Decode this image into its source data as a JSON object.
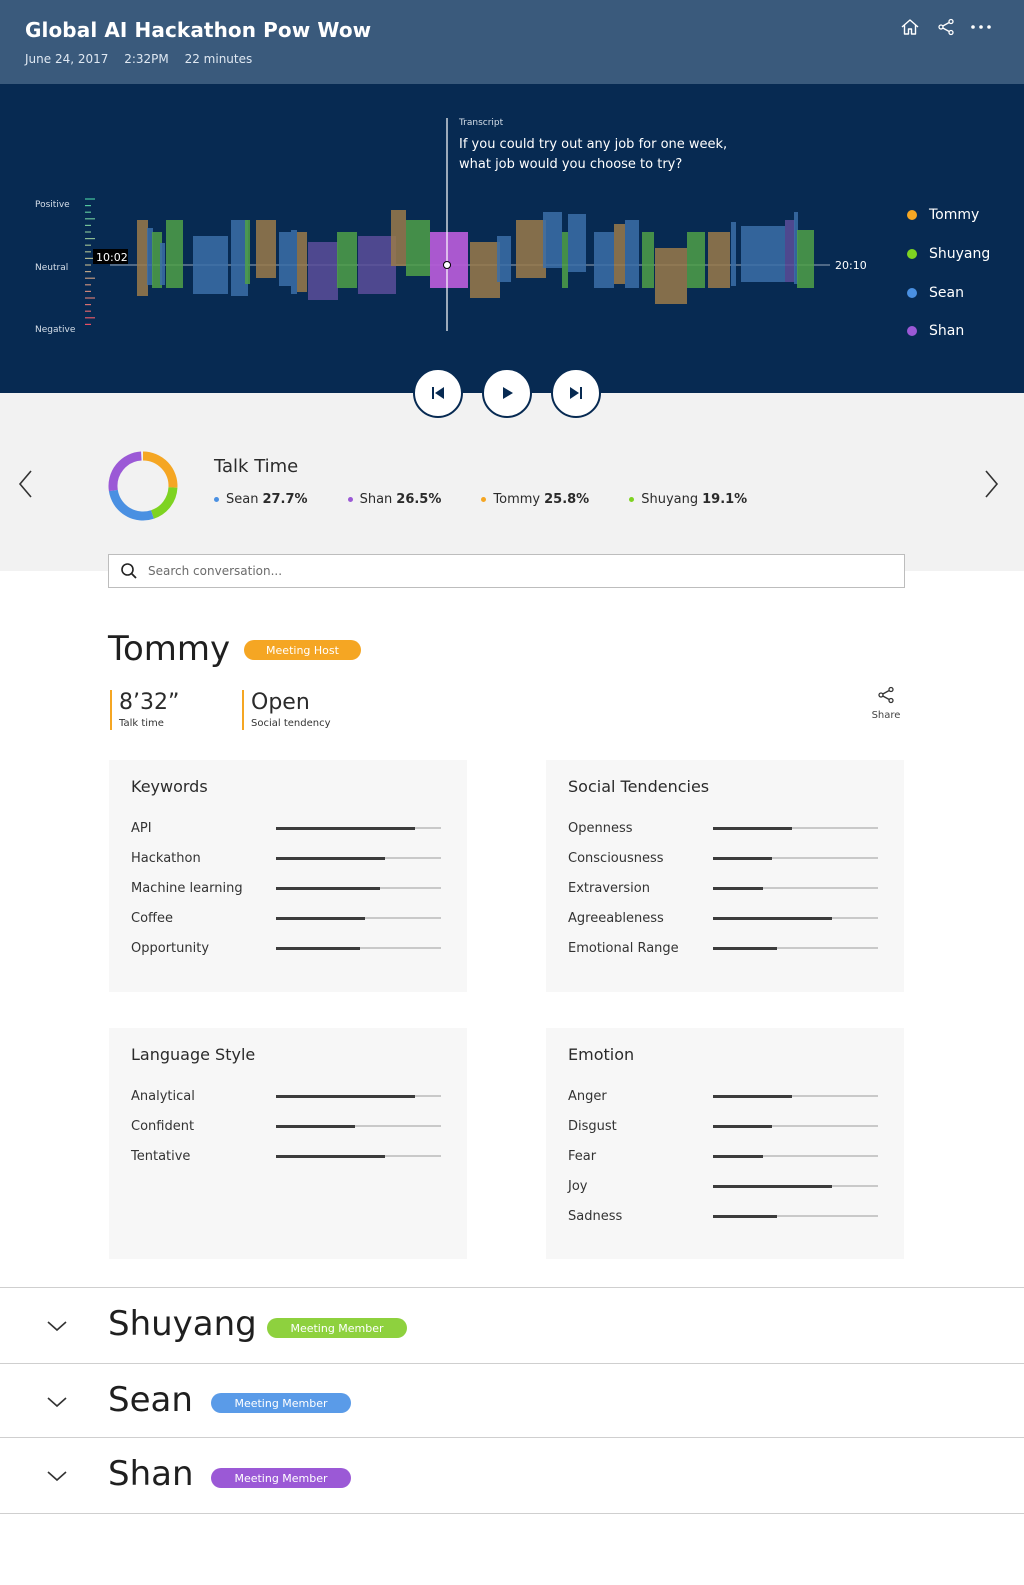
{
  "header": {
    "title": "Global AI Hackathon Pow Wow",
    "date": "June 24, 2017",
    "time": "2:32PM",
    "duration": "22 minutes",
    "icons": [
      "home-icon",
      "share-icon",
      "more-icon"
    ]
  },
  "timeline": {
    "transcript_label": "Transcript",
    "transcript_line1": "If you could try out any job for one week,",
    "transcript_line2": "what job would you choose to try?",
    "scale": {
      "positive": "Positive",
      "neutral": "Neutral",
      "negative": "Negative"
    },
    "current_time": "10:02",
    "end_time": "20:10"
  },
  "legend": [
    {
      "name": "Tommy",
      "color": "#f5a623"
    },
    {
      "name": "Shuyang",
      "color": "#7ed321"
    },
    {
      "name": "Sean",
      "color": "#4a90e2"
    },
    {
      "name": "Shan",
      "color": "#9b59d6"
    }
  ],
  "talk_time": {
    "title": "Talk Time",
    "stats": [
      {
        "name": "Sean",
        "pct": "27.7%",
        "color": "#4a90e2"
      },
      {
        "name": "Shan",
        "pct": "26.5%",
        "color": "#9b59d6"
      },
      {
        "name": "Tommy",
        "pct": "25.8%",
        "color": "#f5a623"
      },
      {
        "name": "Shuyang",
        "pct": "19.1%",
        "color": "#7ed321"
      }
    ]
  },
  "search": {
    "placeholder": "Search conversation..."
  },
  "person": {
    "name": "Tommy",
    "role": "Meeting Host",
    "role_color": "#f5a623",
    "talk_time_value": "8’32”",
    "talk_time_label": "Talk time",
    "tendency_value": "Open",
    "tendency_label": "Social tendency",
    "share_label": "Share"
  },
  "cards": {
    "keywords": {
      "title": "Keywords",
      "rows": [
        {
          "label": "API",
          "value": 0.84
        },
        {
          "label": "Hackathon",
          "value": 0.66
        },
        {
          "label": "Machine learning",
          "value": 0.63
        },
        {
          "label": "Coffee",
          "value": 0.54
        },
        {
          "label": "Opportunity",
          "value": 0.51
        }
      ]
    },
    "social": {
      "title": "Social Tendencies",
      "rows": [
        {
          "label": "Openness",
          "value": 0.48
        },
        {
          "label": "Consciousness",
          "value": 0.36
        },
        {
          "label": "Extraversion",
          "value": 0.3
        },
        {
          "label": "Agreeableness",
          "value": 0.72
        },
        {
          "label": "Emotional Range",
          "value": 0.39
        }
      ]
    },
    "language": {
      "title": "Language Style",
      "rows": [
        {
          "label": "Analytical",
          "value": 0.84
        },
        {
          "label": "Confident",
          "value": 0.48
        },
        {
          "label": "Tentative",
          "value": 0.66
        }
      ]
    },
    "emotion": {
      "title": "Emotion",
      "rows": [
        {
          "label": "Anger",
          "value": 0.48
        },
        {
          "label": "Disgust",
          "value": 0.36
        },
        {
          "label": "Fear",
          "value": 0.3
        },
        {
          "label": "Joy",
          "value": 0.72
        },
        {
          "label": "Sadness",
          "value": 0.39
        }
      ]
    }
  },
  "members": [
    {
      "name": "Shuyang",
      "role": "Meeting Member",
      "color": "#8ed13e"
    },
    {
      "name": "Sean",
      "role": "Meeting Member",
      "color": "#5a9be8"
    },
    {
      "name": "Shan",
      "role": "Meeting Member",
      "color": "#9b59d6"
    }
  ]
}
